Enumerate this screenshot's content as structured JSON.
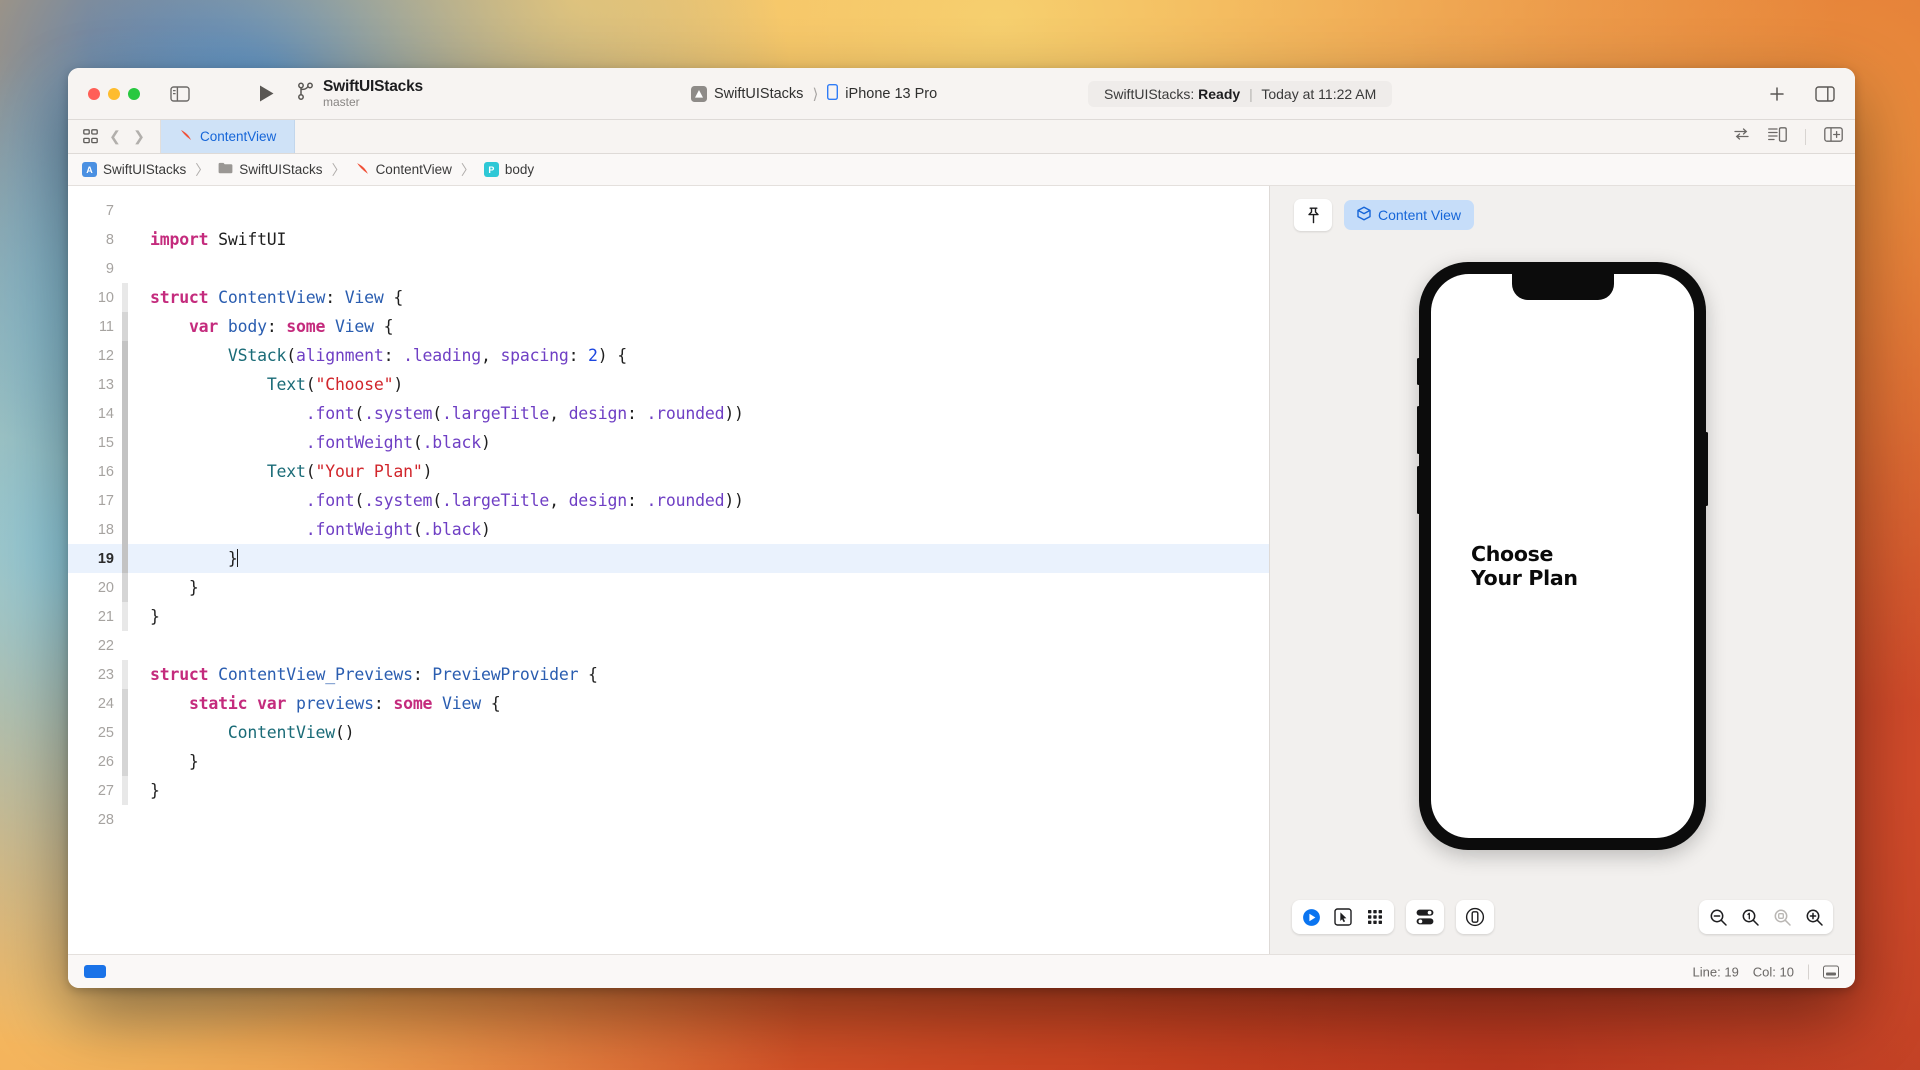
{
  "window": {
    "traffic_lights": [
      "close",
      "minimize",
      "zoom"
    ],
    "scheme_name": "SwiftUIStacks",
    "branch": "master",
    "destination_app": "SwiftUIStacks",
    "destination_device": "iPhone 13 Pro",
    "status_prefix": "SwiftUIStacks:",
    "status_state": "Ready",
    "status_separator": "|",
    "status_time": "Today at 11:22 AM"
  },
  "tabbar": {
    "document_tab": "ContentView"
  },
  "breadcrumb": {
    "items": [
      {
        "label": "SwiftUIStacks",
        "icon": "project-icon"
      },
      {
        "label": "SwiftUIStacks",
        "icon": "folder-icon"
      },
      {
        "label": "ContentView",
        "icon": "swift-file-icon"
      },
      {
        "label": "body",
        "icon": "property-icon"
      }
    ],
    "project_initial": "A",
    "property_initial": "P",
    "separator": "〉"
  },
  "editor": {
    "current_line": 19,
    "lines": [
      {
        "n": 7,
        "gutter": "none",
        "tokens": []
      },
      {
        "n": 8,
        "gutter": "none",
        "tokens": [
          {
            "t": "import",
            "c": "kw"
          },
          {
            "t": " ",
            "c": "pln"
          },
          {
            "t": "SwiftUI",
            "c": "pln"
          }
        ]
      },
      {
        "n": 9,
        "gutter": "none",
        "tokens": []
      },
      {
        "n": 10,
        "gutter": "g1",
        "tokens": [
          {
            "t": "struct",
            "c": "kw"
          },
          {
            "t": " ",
            "c": "pln"
          },
          {
            "t": "ContentView",
            "c": "typ"
          },
          {
            "t": ": ",
            "c": "pln"
          },
          {
            "t": "View",
            "c": "typ"
          },
          {
            "t": " {",
            "c": "pln"
          }
        ]
      },
      {
        "n": 11,
        "gutter": "g2",
        "tokens": [
          {
            "t": "    ",
            "c": "pln"
          },
          {
            "t": "var",
            "c": "kw"
          },
          {
            "t": " ",
            "c": "pln"
          },
          {
            "t": "body",
            "c": "typ"
          },
          {
            "t": ": ",
            "c": "pln"
          },
          {
            "t": "some",
            "c": "kw"
          },
          {
            "t": " ",
            "c": "pln"
          },
          {
            "t": "View",
            "c": "typ"
          },
          {
            "t": " {",
            "c": "pln"
          }
        ]
      },
      {
        "n": 12,
        "gutter": "g3",
        "tokens": [
          {
            "t": "        ",
            "c": "pln"
          },
          {
            "t": "VStack",
            "c": "typ2"
          },
          {
            "t": "(",
            "c": "pln"
          },
          {
            "t": "alignment",
            "c": "mth"
          },
          {
            "t": ": ",
            "c": "pln"
          },
          {
            "t": ".leading",
            "c": "mth"
          },
          {
            "t": ", ",
            "c": "pln"
          },
          {
            "t": "spacing",
            "c": "mth"
          },
          {
            "t": ": ",
            "c": "pln"
          },
          {
            "t": "2",
            "c": "num"
          },
          {
            "t": ") {",
            "c": "pln"
          }
        ]
      },
      {
        "n": 13,
        "gutter": "g3",
        "tokens": [
          {
            "t": "            ",
            "c": "pln"
          },
          {
            "t": "Text",
            "c": "typ2"
          },
          {
            "t": "(",
            "c": "pln"
          },
          {
            "t": "\"Choose\"",
            "c": "str"
          },
          {
            "t": ")",
            "c": "pln"
          }
        ]
      },
      {
        "n": 14,
        "gutter": "g3",
        "tokens": [
          {
            "t": "                ",
            "c": "pln"
          },
          {
            "t": ".font",
            "c": "mth"
          },
          {
            "t": "(",
            "c": "pln"
          },
          {
            "t": ".system",
            "c": "mth"
          },
          {
            "t": "(",
            "c": "pln"
          },
          {
            "t": ".largeTitle",
            "c": "mth"
          },
          {
            "t": ", ",
            "c": "pln"
          },
          {
            "t": "design",
            "c": "mth"
          },
          {
            "t": ": ",
            "c": "pln"
          },
          {
            "t": ".rounded",
            "c": "mth"
          },
          {
            "t": "))",
            "c": "pln"
          }
        ]
      },
      {
        "n": 15,
        "gutter": "g3",
        "tokens": [
          {
            "t": "                ",
            "c": "pln"
          },
          {
            "t": ".fontWeight",
            "c": "mth"
          },
          {
            "t": "(",
            "c": "pln"
          },
          {
            "t": ".black",
            "c": "mth"
          },
          {
            "t": ")",
            "c": "pln"
          }
        ]
      },
      {
        "n": 16,
        "gutter": "g3",
        "tokens": [
          {
            "t": "            ",
            "c": "pln"
          },
          {
            "t": "Text",
            "c": "typ2"
          },
          {
            "t": "(",
            "c": "pln"
          },
          {
            "t": "\"Your Plan\"",
            "c": "str"
          },
          {
            "t": ")",
            "c": "pln"
          }
        ]
      },
      {
        "n": 17,
        "gutter": "g3",
        "tokens": [
          {
            "t": "                ",
            "c": "pln"
          },
          {
            "t": ".font",
            "c": "mth"
          },
          {
            "t": "(",
            "c": "pln"
          },
          {
            "t": ".system",
            "c": "mth"
          },
          {
            "t": "(",
            "c": "pln"
          },
          {
            "t": ".largeTitle",
            "c": "mth"
          },
          {
            "t": ", ",
            "c": "pln"
          },
          {
            "t": "design",
            "c": "mth"
          },
          {
            "t": ": ",
            "c": "pln"
          },
          {
            "t": ".rounded",
            "c": "mth"
          },
          {
            "t": "))",
            "c": "pln"
          }
        ]
      },
      {
        "n": 18,
        "gutter": "g3",
        "tokens": [
          {
            "t": "                ",
            "c": "pln"
          },
          {
            "t": ".fontWeight",
            "c": "mth"
          },
          {
            "t": "(",
            "c": "pln"
          },
          {
            "t": ".black",
            "c": "mth"
          },
          {
            "t": ")",
            "c": "pln"
          }
        ]
      },
      {
        "n": 19,
        "gutter": "g3",
        "caret": true,
        "tokens": [
          {
            "t": "        }",
            "c": "pln"
          }
        ]
      },
      {
        "n": 20,
        "gutter": "g2",
        "tokens": [
          {
            "t": "    }",
            "c": "pln"
          }
        ]
      },
      {
        "n": 21,
        "gutter": "g1",
        "tokens": [
          {
            "t": "}",
            "c": "pln"
          }
        ]
      },
      {
        "n": 22,
        "gutter": "none",
        "tokens": []
      },
      {
        "n": 23,
        "gutter": "g1",
        "tokens": [
          {
            "t": "struct",
            "c": "kw"
          },
          {
            "t": " ",
            "c": "pln"
          },
          {
            "t": "ContentView_Previews",
            "c": "typ"
          },
          {
            "t": ": ",
            "c": "pln"
          },
          {
            "t": "PreviewProvider",
            "c": "typ"
          },
          {
            "t": " {",
            "c": "pln"
          }
        ]
      },
      {
        "n": 24,
        "gutter": "g2",
        "tokens": [
          {
            "t": "    ",
            "c": "pln"
          },
          {
            "t": "static",
            "c": "kw"
          },
          {
            "t": " ",
            "c": "pln"
          },
          {
            "t": "var",
            "c": "kw"
          },
          {
            "t": " ",
            "c": "pln"
          },
          {
            "t": "previews",
            "c": "typ"
          },
          {
            "t": ": ",
            "c": "pln"
          },
          {
            "t": "some",
            "c": "kw"
          },
          {
            "t": " ",
            "c": "pln"
          },
          {
            "t": "View",
            "c": "typ"
          },
          {
            "t": " {",
            "c": "pln"
          }
        ]
      },
      {
        "n": 25,
        "gutter": "g2",
        "tokens": [
          {
            "t": "        ",
            "c": "pln"
          },
          {
            "t": "ContentView",
            "c": "typ2"
          },
          {
            "t": "()",
            "c": "pln"
          }
        ]
      },
      {
        "n": 26,
        "gutter": "g2",
        "tokens": [
          {
            "t": "    }",
            "c": "pln"
          }
        ]
      },
      {
        "n": 27,
        "gutter": "g1",
        "tokens": [
          {
            "t": "}",
            "c": "pln"
          }
        ]
      },
      {
        "n": 28,
        "gutter": "none",
        "tokens": []
      }
    ]
  },
  "canvas": {
    "pin_label": "pin-icon",
    "preview_name": "Content View",
    "preview_lines": [
      "Choose",
      "Your Plan"
    ],
    "bottom_controls": [
      {
        "name": "live-preview-play-button",
        "icon": "play-circle-icon"
      },
      {
        "name": "selectable-mode-button",
        "icon": "cursor-box-icon"
      },
      {
        "name": "variants-button",
        "icon": "grid-9-icon"
      },
      {
        "name": "device-settings-button",
        "icon": "sliders-icon"
      },
      {
        "name": "device-bezel-button",
        "icon": "device-circle-icon"
      }
    ],
    "zoom_controls": [
      {
        "name": "zoom-out-button",
        "icon": "magnifier-minus-icon"
      },
      {
        "name": "zoom-actual-size-button",
        "icon": "magnifier-one-icon"
      },
      {
        "name": "zoom-to-fit-button",
        "icon": "magnifier-fit-icon",
        "disabled": true
      },
      {
        "name": "zoom-in-button",
        "icon": "magnifier-plus-icon"
      }
    ]
  },
  "footer": {
    "line_label": "Line: 19",
    "col_label": "Col: 10"
  },
  "colors": {
    "accent_blue": "#1565d8",
    "tab_active_bg": "#cfe2f7",
    "current_line_bg": "#eaf2fd",
    "keyword": "#c42b7d",
    "type": "#2a5db0",
    "method": "#6f3fc4",
    "string": "#d1252b",
    "number": "#1c46e0"
  }
}
